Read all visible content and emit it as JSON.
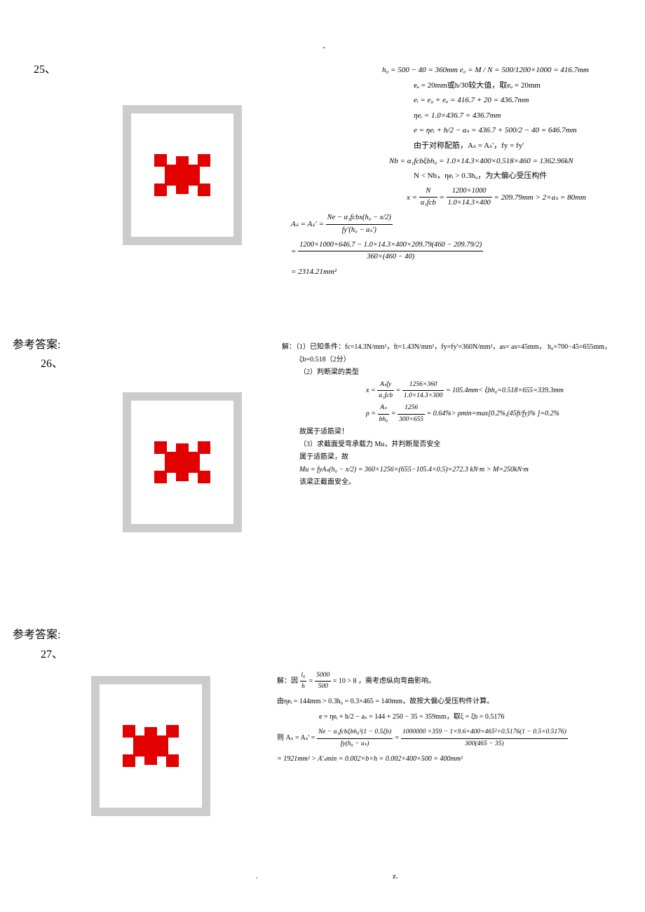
{
  "header": {
    "dash": "-"
  },
  "questions": {
    "q25": "25、",
    "q26": "26、",
    "q27": "27、"
  },
  "labels": {
    "answer": "参考答案:"
  },
  "math25": {
    "l1": "h₀ = 500 − 40 = 360mm   e₀ = M / N = 500/1200×1000 = 416.7mm",
    "l2": "eₐ = 20mm或h/30较大值，取eₐ = 20mm",
    "l3": "eᵢ = e₀ + eₐ = 416.7 + 20 = 436.7mm",
    "l4": "ηeᵢ = 1.0×436.7 = 436.7mm",
    "l5": "e = ηeᵢ + h/2 − aₛ = 436.7 + 500/2 − 40 = 646.7mm",
    "l6": "由于对称配筋，Aₛ = Aₛ'，fy = fy'",
    "l7": "Nb = α₁fcbξbh₀ = 1.0×14.3×400×0.518×460 = 1362.96kN",
    "l8": "N < Nb，ηeᵢ > 0.3h₀，为大偏心受压构件",
    "l9a": "x =",
    "l9b": "N",
    "l9c": "α₁fcb",
    "l9d": "=",
    "l9e": "1200×1000",
    "l9f": "1.0×14.3×400",
    "l9g": "= 209.79mm > 2×aₛ = 80mm",
    "l10a": "Aₛ = Aₛ' =",
    "l10b": "Ne − α₁fcbx(h₀ − x/2)",
    "l10c": "fy'(h₀ − aₛ')",
    "l11a": "=",
    "l11b": "1200×1000×646.7 − 1.0×14.3×400×209.79(460 − 209.79/2)",
    "l11c": "360×(460 − 40)",
    "l12": "= 2314.21mm²"
  },
  "math26": {
    "l1": "解：（1）已知条件：fc=14.3N/mm²，ft=1.43N/mm²，fy=fy'=360N/mm²，as= as=45mm，  h₀=700−45=655mm，",
    "l1b": "ξb=0.518（2分）",
    "l2": "（2）判断梁的类型",
    "l3a": "x =",
    "l3b": "Aₛfy",
    "l3c": "α₁fcb",
    "l3d": "=",
    "l3e": "1256×360",
    "l3f": "1.0×14.3×300",
    "l3g": "= 105.4mm< ξbh₀=0.518×655=339.3mm",
    "l4a": "ρ =",
    "l4b": "Aₛ",
    "l4c": "bh₀",
    "l4d": "=",
    "l4e": "1256",
    "l4f": "300×655",
    "l4g": "= 0.64%> ρmin=max[0.2%,(45ft/fy)% ]=0.2%",
    "l5": "故属于适筋梁！",
    "l6": "（3）求截面受弯承载力 Mu，并判断是否安全",
    "l7": "属于适筋梁，故",
    "l8": "Mu = fyAₛ(h₀ − x/2) = 360×1256×(655−105.4×0.5)=272.3 kN·m > M=250kN·m",
    "l9": "该梁正截面安全。"
  },
  "math27": {
    "l1a": "解：因",
    "l1b": "l₀",
    "l1c": "h",
    "l1d": "=",
    "l1e": "5000",
    "l1f": "500",
    "l1g": "= 10 > 8 ，需考虑纵向弯曲影响。",
    "l2": "由ηeᵢ = 144mm > 0.3h₀ = 0.3×465 = 140mm，故按大偏心受压构件计算。",
    "l3": "e = ηeᵢ + h/2 − aₛ = 144 + 250 − 35 = 359mm，取ξ = ξb = 0.5176",
    "l4a": "则   Aₛ = Aₛ' =",
    "l4b": "Ne − α₁fcbξbh₀²(1 − 0.5ξb)",
    "l4c": "fy(h₀ − aₛ)",
    "l4d": "=",
    "l4e": "1000000 ×359 − 1×9.6×400×465²×0.5176(1 − 0.5×0.5176)",
    "l4f": "300(465 − 35)",
    "l5": "= 1921mm² > A'ₛmin = 0.002×b×h = 0.002×400×500 = 400mm²"
  },
  "footer": {
    "dot": ".",
    "z": "z."
  }
}
